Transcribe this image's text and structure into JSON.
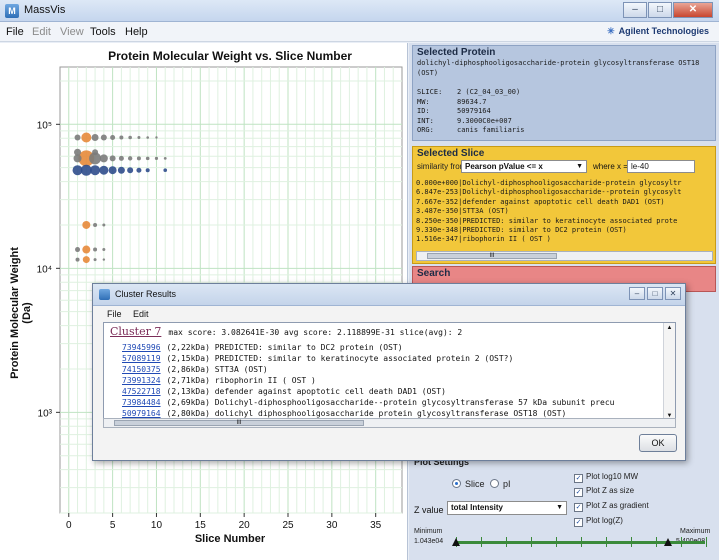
{
  "window": {
    "title": "MassVis",
    "app_icon": "massvis-app-icon"
  },
  "menu": {
    "file": "File",
    "edit": "Edit",
    "view": "View",
    "tools": "Tools",
    "help": "Help"
  },
  "brand": "Agilent Technologies",
  "chart_data": {
    "type": "scatter",
    "title": "Protein Molecular Weight vs. Slice Number",
    "xlabel": "Slice Number",
    "ylabel": "Protein Molecular Weight (Da)",
    "x_ticks": [
      "0",
      "5",
      "10",
      "15",
      "20",
      "25",
      "30",
      "35"
    ],
    "y_ticks": [
      "10⁵",
      "10⁴",
      "10³"
    ],
    "xlim": [
      -1,
      38
    ],
    "ylim": [
      200,
      250000
    ],
    "yscale": "log",
    "grid": true,
    "series": [
      {
        "name": "",
        "color": "#e7893a",
        "points": [
          {
            "x": 2,
            "y": 81000,
            "s": 5
          },
          {
            "x": 2,
            "y": 58000,
            "s": 8
          },
          {
            "x": 2,
            "y": 20000,
            "s": 4
          },
          {
            "x": 2,
            "y": 13500,
            "s": 4
          },
          {
            "x": 2,
            "y": 11500,
            "s": 3.5
          }
        ]
      },
      {
        "name": "",
        "color": "#7b7b7b",
        "points": [
          {
            "x": 1,
            "y": 81000,
            "s": 3
          },
          {
            "x": 3,
            "y": 81000,
            "s": 3.5
          },
          {
            "x": 4,
            "y": 81000,
            "s": 3
          },
          {
            "x": 5,
            "y": 81000,
            "s": 2.5
          },
          {
            "x": 6,
            "y": 81000,
            "s": 2
          },
          {
            "x": 7,
            "y": 81000,
            "s": 1.8
          },
          {
            "x": 8,
            "y": 81000,
            "s": 1.5
          },
          {
            "x": 9,
            "y": 81000,
            "s": 1.3
          },
          {
            "x": 10,
            "y": 81000,
            "s": 1.2
          },
          {
            "x": 1,
            "y": 58000,
            "s": 4
          },
          {
            "x": 1,
            "y": 64000,
            "s": 3.5
          },
          {
            "x": 3,
            "y": 58000,
            "s": 6
          },
          {
            "x": 3,
            "y": 64000,
            "s": 3
          },
          {
            "x": 4,
            "y": 58000,
            "s": 4
          },
          {
            "x": 5,
            "y": 58000,
            "s": 3
          },
          {
            "x": 6,
            "y": 58000,
            "s": 2.5
          },
          {
            "x": 7,
            "y": 58000,
            "s": 2.2
          },
          {
            "x": 8,
            "y": 58000,
            "s": 2
          },
          {
            "x": 9,
            "y": 58000,
            "s": 1.8
          },
          {
            "x": 10,
            "y": 58000,
            "s": 1.6
          },
          {
            "x": 11,
            "y": 58000,
            "s": 1.4
          },
          {
            "x": 3,
            "y": 20000,
            "s": 2
          },
          {
            "x": 4,
            "y": 20000,
            "s": 1.5
          },
          {
            "x": 1,
            "y": 13500,
            "s": 2.5
          },
          {
            "x": 3,
            "y": 13500,
            "s": 2
          },
          {
            "x": 4,
            "y": 13500,
            "s": 1.5
          },
          {
            "x": 1,
            "y": 11500,
            "s": 2
          },
          {
            "x": 3,
            "y": 11500,
            "s": 1.5
          },
          {
            "x": 4,
            "y": 11500,
            "s": 1.2
          }
        ]
      },
      {
        "name": "",
        "color": "#2f4d8c",
        "points": [
          {
            "x": 1,
            "y": 48000,
            "s": 5
          },
          {
            "x": 2,
            "y": 48000,
            "s": 5.5
          },
          {
            "x": 3,
            "y": 48000,
            "s": 5
          },
          {
            "x": 4,
            "y": 48000,
            "s": 4.5
          },
          {
            "x": 5,
            "y": 48000,
            "s": 4
          },
          {
            "x": 6,
            "y": 48000,
            "s": 3.5
          },
          {
            "x": 7,
            "y": 48000,
            "s": 3
          },
          {
            "x": 8,
            "y": 48000,
            "s": 2.5
          },
          {
            "x": 9,
            "y": 48000,
            "s": 2
          },
          {
            "x": 11,
            "y": 48000,
            "s": 1.8
          }
        ]
      }
    ]
  },
  "selected_protein": {
    "title": "Selected Protein",
    "name": "dolichyl-diphosphooligosaccharide-protein glycosyltransferase OST18 (OST)",
    "rows": [
      {
        "label": "SLICE:",
        "value": "2 (C2_04_03_00)"
      },
      {
        "label": "MW:",
        "value": "89634.7"
      },
      {
        "label": "ID:",
        "value": "50979164"
      },
      {
        "label": "INT:",
        "value": "9.3000C0e+007"
      },
      {
        "label": "ORG:",
        "value": "canis familiaris"
      }
    ]
  },
  "selected_slice": {
    "title": "Selected Slice",
    "similarity_label": "similarity from",
    "similarity_value": "Pearson pValue <= x",
    "where_label": "where x =",
    "where_value": "le-40",
    "items": [
      "0.000e+000|Dolichyl-diphosphooligosaccharide-protein glycosyltr",
      "6.847e-253|Dolichyl-diphosphooligosaccharide--protein glycosylt",
      "7.667e-352|defender against apoptotic cell death DAD1 (OST)",
      "3.487e-350|STT3A (OST)",
      "8.250e-350|PREDICTED: similar to keratinocyte associated prote",
      "9.330e-348|PREDICTED: similar to DC2 protein (OST)",
      "1.516e-347|ribophorin II  ( OST )"
    ],
    "scroll_grip": "III"
  },
  "search": {
    "title": "Search"
  },
  "plot_settings": {
    "title": "Plot Settings",
    "radio_slice": "Slice",
    "radio_pi": "pI",
    "check_log": "Plot log10 MW",
    "check_zsize": "Plot Z as size",
    "check_zgradient": "Plot Z as gradient",
    "check_logz": "Plot log(Z)",
    "check_mark": "✓",
    "zvalue_label": "Z value",
    "zvalue_selected": "total Intensity",
    "min_label": "Minimum",
    "min_value": "1.043e04",
    "max_label": "Maximum",
    "max_value": "5.400e08"
  },
  "cluster_dialog": {
    "title": "Cluster Results",
    "menu_file": "File",
    "menu_edit": "Edit",
    "cluster_label": "Cluster 7",
    "meta": "max score: 3.082641E-30 avg score: 2.118899E-31 slice(avg): 2",
    "rows": [
      {
        "id": "73945996",
        "text": "(2,22kDa) PREDICTED: similar to DC2 protein (OST)"
      },
      {
        "id": "57089119",
        "text": "(2,15kDa) PREDICTED: similar to keratinocyte associated protein 2 (OST?)"
      },
      {
        "id": "74150375",
        "text": "(2,86kDa) STT3A (OST)"
      },
      {
        "id": "73991324",
        "text": "(2,71kDa) ribophorin II  ( OST )"
      },
      {
        "id": "47522718",
        "text": "(2,13kDa) defender against apoptotic cell death DAD1 (OST)"
      },
      {
        "id": "73984484",
        "text": "(2,69kDa) Dolichyl-diphosphooligosaccharide--protein glycosyltransferase 57 kDa subunit precu"
      },
      {
        "id": "50979164",
        "text": "(2,80kDa) dolichyl diphosphooligosaccharide protein glycosyltransferase OST18 (OST)"
      }
    ],
    "ok_label": "OK",
    "scroll_grip": "III"
  }
}
